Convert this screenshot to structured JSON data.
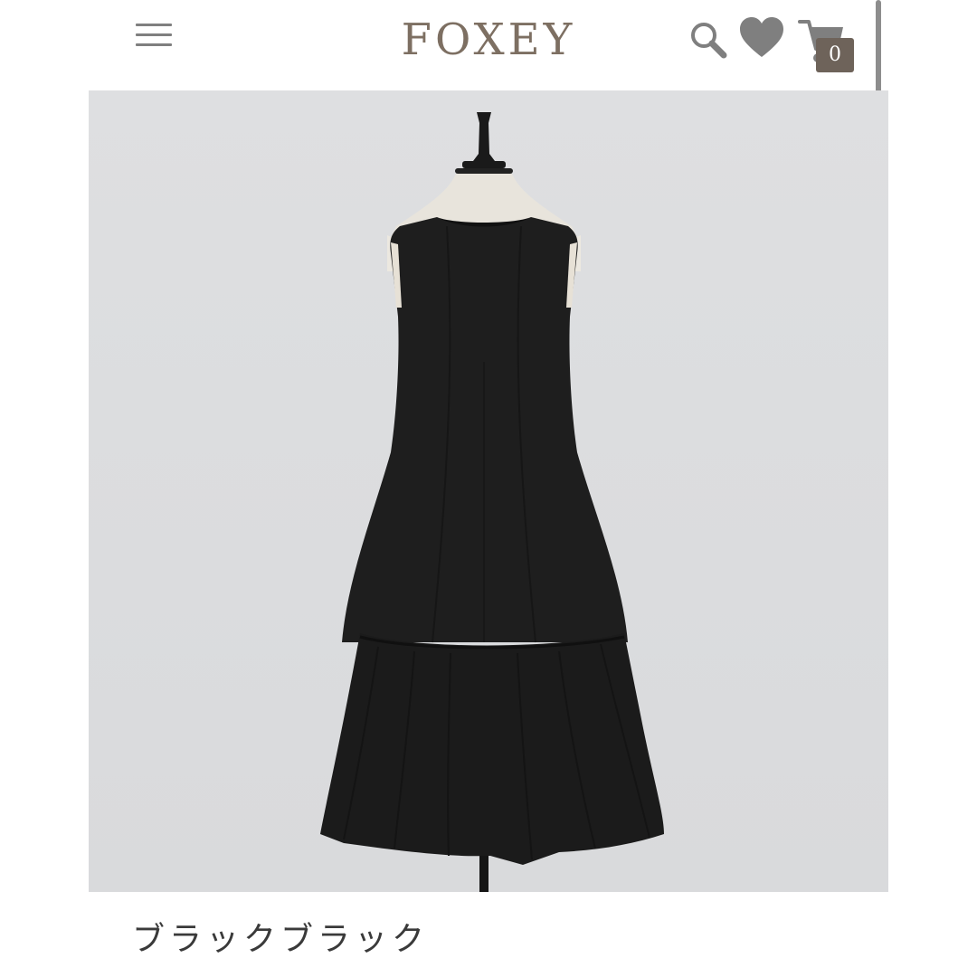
{
  "header": {
    "logo": "FOXEY",
    "cart_count": "0"
  },
  "icons": {
    "menu": "hamburger-menu-icon",
    "search": "search-icon",
    "favorite": "heart-icon",
    "cart": "cart-icon"
  },
  "colors": {
    "brand": "#7d6f62",
    "badge": "#6e635a",
    "image_bg": "#dcdde0",
    "dress": "#1c1c1c"
  },
  "product": {
    "color_name": "ブラックブラック"
  }
}
